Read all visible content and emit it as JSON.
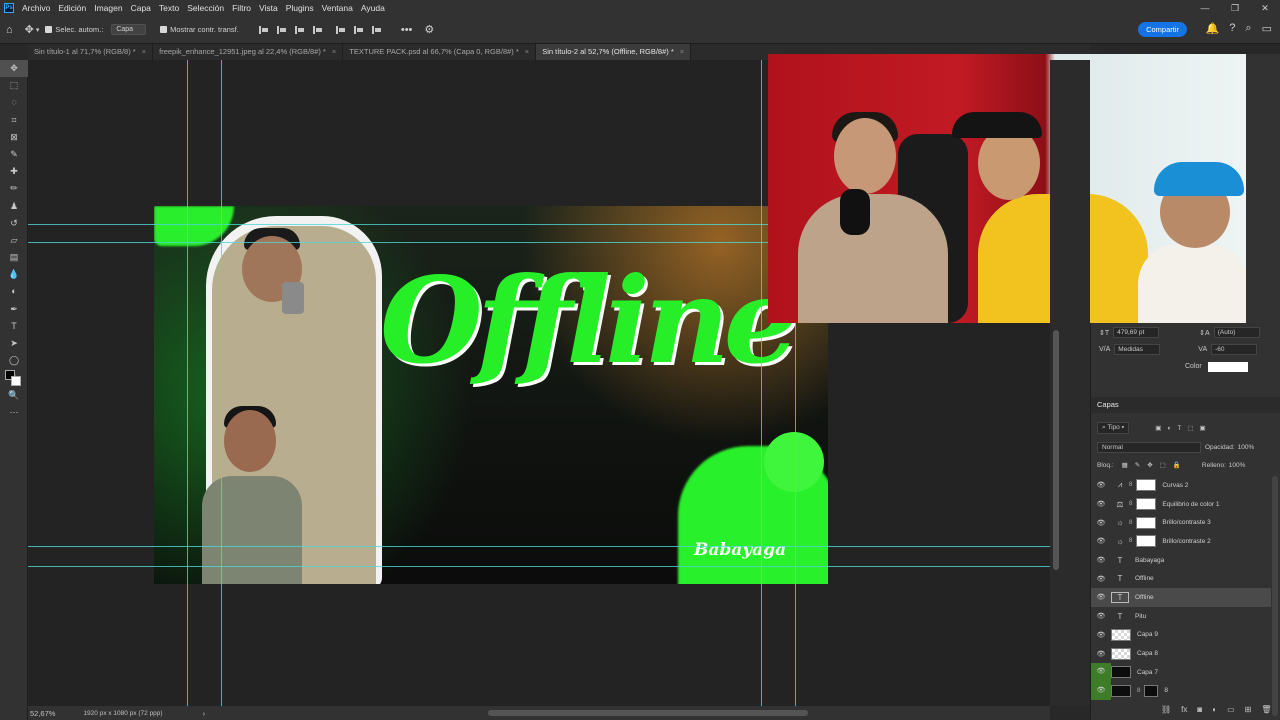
{
  "menubar": {
    "logo": "Ps",
    "items": [
      "Archivo",
      "Edición",
      "Imagen",
      "Capa",
      "Texto",
      "Selección",
      "Filtro",
      "Vista",
      "Plugins",
      "Ventana",
      "Ayuda"
    ],
    "window_controls": [
      "—",
      "❐",
      "✕"
    ]
  },
  "options": {
    "auto_select_label": "Selec. autom.:",
    "auto_select_value": "Capa",
    "show_transform_label": "Mostrar contr. transf.",
    "more": "•••",
    "share_label": "Compartir"
  },
  "tabs": [
    {
      "label": "Sin título-1 al 71,7% (RGB/8) *",
      "active": false
    },
    {
      "label": "freepik_enhance_12951.jpeg al 22,4% (RGB/8#) *",
      "active": false
    },
    {
      "label": "TEXTURE PACK.psd al 66,7% (Capa 0, RGB/8#) *",
      "active": false
    },
    {
      "label": "Sin título-2 al 52,7% (Offline, RGB/8#) *",
      "active": true
    }
  ],
  "canvas": {
    "title_text": "Offline",
    "signature_text": "Babayaga"
  },
  "status": {
    "zoom": "52,67%",
    "doc_size": "1920 px x 1080 px (72 ppp)"
  },
  "character": {
    "leading": "479,69 pt",
    "leading_auto": "(Auto)",
    "kerning_label": "Medidas",
    "tracking": "-60",
    "color_label": "Color",
    "text_color": "#ffffff"
  },
  "layers_panel": {
    "title": "Capas",
    "filter_label": "Tipo",
    "blend_mode": "Normal",
    "opacity_label": "Opacidad:",
    "opacity_value": "100%",
    "lock_label": "Bloq.:",
    "fill_label": "Relleno:",
    "fill_value": "100%",
    "layers": [
      {
        "name": "Curvas 2",
        "kind": "adjust",
        "active": false
      },
      {
        "name": "Equilibrio de color 1",
        "kind": "adjust",
        "active": false
      },
      {
        "name": "Brillo/contraste 3",
        "kind": "adjust",
        "active": false
      },
      {
        "name": "Brillo/contraste 2",
        "kind": "adjust",
        "active": false
      },
      {
        "name": "Babayaga",
        "kind": "text",
        "active": false
      },
      {
        "name": "Offline",
        "kind": "text",
        "active": false
      },
      {
        "name": "Offline",
        "kind": "text",
        "active": true
      },
      {
        "name": "Pitu",
        "kind": "text",
        "active": false
      },
      {
        "name": "Capa 9",
        "kind": "pixel",
        "active": false
      },
      {
        "name": "Capa 8",
        "kind": "pixel",
        "active": false
      },
      {
        "name": "Capa 7",
        "kind": "black",
        "active": false
      },
      {
        "name": "8",
        "kind": "black",
        "active": false
      }
    ]
  },
  "colors": {
    "accent_green": "#26ef28",
    "guide": "#4fd6d6",
    "share_blue": "#1473e6"
  }
}
